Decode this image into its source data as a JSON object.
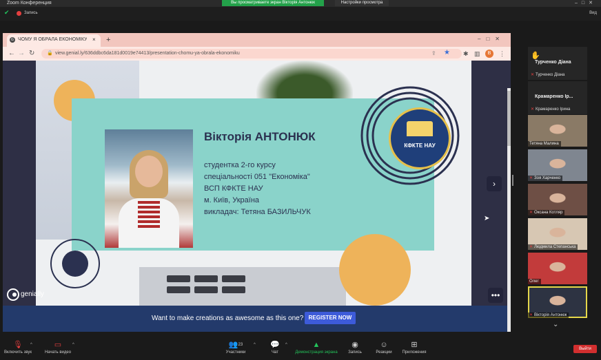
{
  "zoom": {
    "window_title": "Zoom Конференция",
    "share_banner": "Вы просматриваете экран Вікторія Антонюк",
    "view_settings": "Настройки просмотра",
    "window_controls": "–□✕",
    "recording_label": "Запись",
    "view_button": "Вид"
  },
  "browser": {
    "tab_title": "ЧОМУ Я ОБРАЛА ЕКОНОМІКУ",
    "tab_favicon": "G",
    "url": "view.genial.ly/636ddbc6da181d0019e74413/presentation-chomu-ya-obrala-ekonomiku",
    "profile_initial": "B"
  },
  "slide": {
    "name": "Вікторія АНТОНЮК",
    "lines": [
      "студентка 2-го курсу",
      "спеціальності 051 \"Економіка\"",
      "ВСП КФКТЕ НАУ",
      "м. Київ, Україна",
      "викладач: Тетяна БАЗИЛЬЧУК"
    ],
    "logo_text": "КФКТЕ НАУ",
    "brand": "genially",
    "promo_text": "Want to make creations as awesome as this one?",
    "register_button": "REGISTER NOW"
  },
  "participants": {
    "name_cards": [
      {
        "title": "Турченко Діана",
        "mic_label": "Турченко Діана"
      },
      {
        "title": "Крамаренко Ір...",
        "mic_label": "Крамаренко Ірина"
      }
    ],
    "thumbnails": [
      {
        "label": "Тетяна Малина",
        "muted": false,
        "bg": "#8a7a66"
      },
      {
        "label": "Зоя Харченко",
        "muted": true,
        "bg": "#7f8690"
      },
      {
        "label": "Оксана Котляр",
        "muted": true,
        "bg": "#6e4f45"
      },
      {
        "label": "Людмила Степанська",
        "muted": true,
        "bg": "#d7c7b3"
      },
      {
        "label": "Олег",
        "muted": false,
        "bg": "#c23b3b"
      },
      {
        "label": "Вікторія Антонюк",
        "muted": true,
        "bg": "#2d3342"
      }
    ]
  },
  "toolbar": {
    "audio": "Включить звук",
    "video": "Начать видео",
    "participants": "Участники",
    "participants_count": "23",
    "chat": "Чат",
    "share": "Демонстрация экрана",
    "record": "Запись",
    "reactions": "Реакции",
    "apps": "Приложения",
    "end": "Выйти"
  }
}
